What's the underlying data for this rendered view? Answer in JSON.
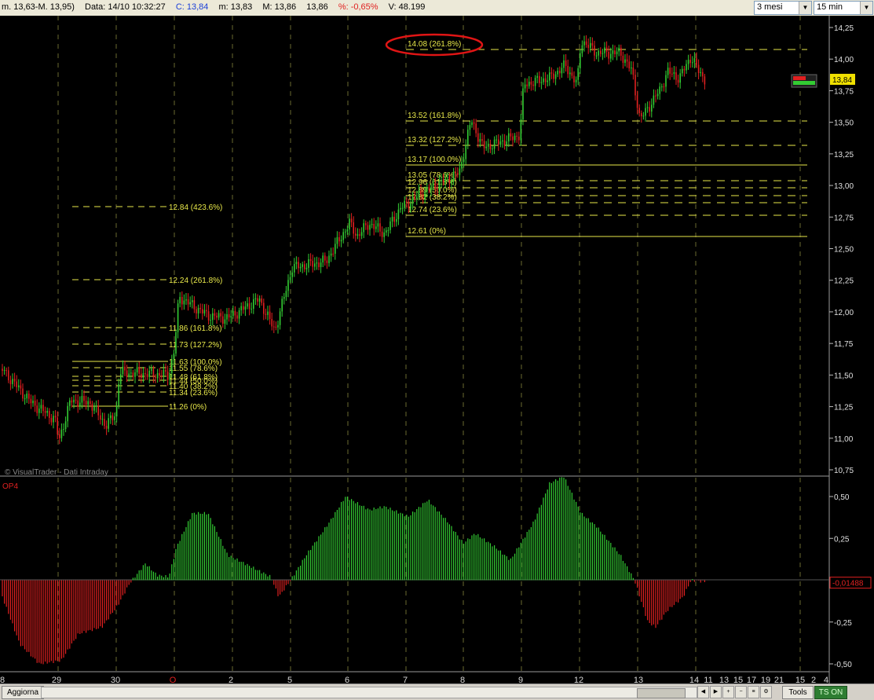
{
  "toolbar": {
    "symbol_range": "m. 13,63-M. 13,95)",
    "date": "Data: 14/10 10:32:27",
    "close": "C: 13,84",
    "low": "m: 13,83",
    "high": "M: 13,86",
    "last": "13,86",
    "pct": "%: -0,65%",
    "volume": "V: 48.199",
    "period": "3 mesi",
    "interval": "15 min"
  },
  "chart": {
    "watermark": "© VisualTrader - Dati Intraday",
    "indicator_name": "OP4",
    "price_tag": "13,84",
    "indicator_tag": "-0,01488",
    "colors": {
      "up": "#33cc33",
      "down": "#e02020",
      "fib": "#e8e84a",
      "grid": "#6a6a30",
      "bg": "#000000"
    },
    "price_axis": [
      "14,25",
      "14,00",
      "13,75",
      "13,50",
      "13,25",
      "13,00",
      "12,75",
      "12,50",
      "12,25",
      "12,00",
      "11,75",
      "11,50",
      "11,25",
      "11,00",
      "10,75"
    ],
    "indicator_axis": [
      "0,50",
      "0,25",
      "-0,25",
      "-0,50"
    ],
    "x_labels": [
      "8",
      "29",
      "30",
      "O",
      "2",
      "5",
      "6",
      "7",
      "8",
      "9",
      "12",
      "13",
      "14",
      "11",
      "13",
      "15",
      "17",
      "19",
      "21",
      "15",
      "2",
      "4"
    ],
    "fib_left": [
      "12.84 (423.6%)",
      "12.24 (261.8%)",
      "11.86 (161.8%)",
      "11.73 (127.2%)",
      "11.63 (100.0%)",
      "11.55 (78.6%)",
      "11.48 (61.8%)",
      "11.44 (50.0%)",
      "11.40 (38.2%)",
      "11.34 (23.6%)",
      "11.26 (0%)"
    ],
    "fib_right": [
      "14.08 (261.8%)",
      "13.52 (161.8%)",
      "13.32 (127.2%)",
      "13.17 (100.0%)",
      "13.05 (78.6%)",
      "12.96 (61.8%)",
      "12.89 (50.0%)",
      "12.82 (38.2%)",
      "12.74 (23.6%)",
      "12.61 (0%)"
    ]
  },
  "footer": {
    "update_label": "Aggiorna",
    "tools_label": "Tools",
    "ts_label": "TS ON"
  }
}
